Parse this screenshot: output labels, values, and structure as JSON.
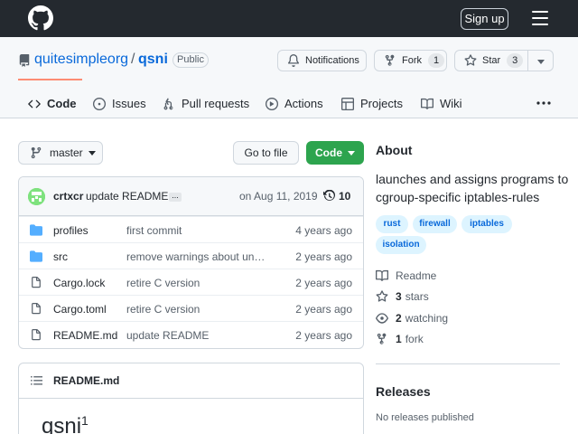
{
  "topbar": {
    "signin_label": "Sign up"
  },
  "repo": {
    "owner": "quitesimpleorg",
    "separator": "/",
    "name": "qsni",
    "visibility": "Public"
  },
  "actions": {
    "notifications_label": "Notifications",
    "fork_label": "Fork",
    "fork_count": "1",
    "star_label": "Star",
    "star_count": "3"
  },
  "tabs": [
    {
      "label": "Code"
    },
    {
      "label": "Issues"
    },
    {
      "label": "Pull requests"
    },
    {
      "label": "Actions"
    },
    {
      "label": "Projects"
    },
    {
      "label": "Wiki"
    }
  ],
  "toolbar": {
    "branch": "master",
    "goto_file_label": "Go to file",
    "code_label": "Code"
  },
  "commit": {
    "author": "crtxcr",
    "message": "update README",
    "more": "...",
    "date": "on Aug 11, 2019",
    "count": "10"
  },
  "files": [
    {
      "type": "dir",
      "name": "profiles",
      "message": "first commit",
      "age": "4 years ago"
    },
    {
      "type": "dir",
      "name": "src",
      "message": "remove warnings about unu…",
      "age": "2 years ago"
    },
    {
      "type": "file",
      "name": "Cargo.lock",
      "message": "retire C version",
      "age": "2 years ago"
    },
    {
      "type": "file",
      "name": "Cargo.toml",
      "message": "retire C version",
      "age": "2 years ago"
    },
    {
      "type": "file",
      "name": "README.md",
      "message": "update README",
      "age": "2 years ago"
    }
  ],
  "readme": {
    "title": "README.md",
    "heading": "qsni",
    "heading_sup": "1"
  },
  "about": {
    "heading": "About",
    "description": "launches and assigns programs to cgroup-specific iptables-rules",
    "topics": [
      "rust",
      "firewall",
      "iptables",
      "isolation"
    ],
    "readme_label": "Readme",
    "stars_count": "3",
    "stars_label": "stars",
    "watching_count": "2",
    "watching_label": "watching",
    "forks_count": "1",
    "forks_label": "fork"
  },
  "releases": {
    "heading": "Releases",
    "empty_text": "No releases published"
  },
  "colors": {
    "primary_link": "#0969da",
    "green_button": "#2da44e",
    "active_tab_underline": "#fd8c73",
    "topbar": "#24292f"
  }
}
